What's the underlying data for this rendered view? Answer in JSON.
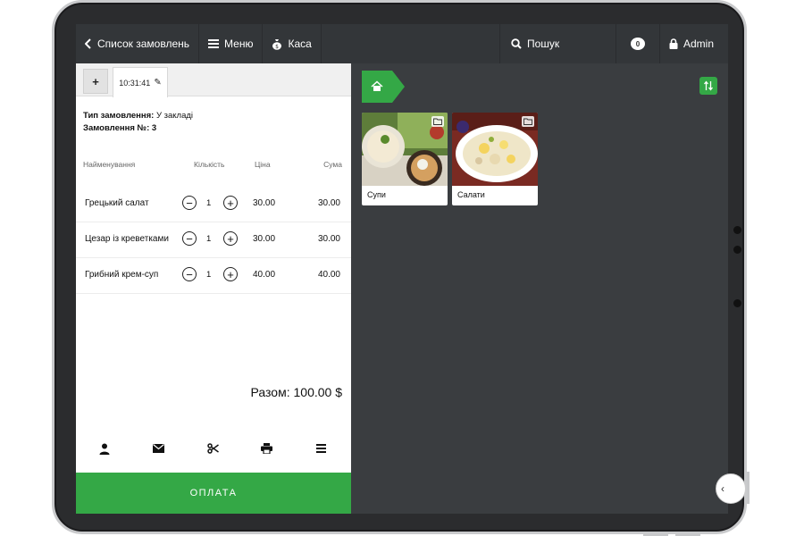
{
  "topbar": {
    "orders_label": "Список замовлень",
    "menu_label": "Меню",
    "cash_label": "Каса",
    "search_label": "Пошук",
    "messages_count": "0",
    "user_label": "Admin"
  },
  "order": {
    "new_tab_label": "+",
    "tab_time": "10:31:41",
    "type_label": "Тип замовлення:",
    "type_value": "У закладі",
    "number_label": "Замовлення №:",
    "number_value": "3",
    "columns": {
      "name": "Найменування",
      "qty": "Кількість",
      "price": "Ціна",
      "sum": "Сума"
    },
    "items": [
      {
        "name": "Грецький салат",
        "qty": "1",
        "price": "30.00",
        "sum": "30.00"
      },
      {
        "name": "Цезар із креветками",
        "qty": "1",
        "price": "30.00",
        "sum": "30.00"
      },
      {
        "name": "Грибний крем-суп",
        "qty": "1",
        "price": "40.00",
        "sum": "40.00"
      }
    ],
    "total": "Разом: 100.00 $",
    "pay_label": "ОПЛАТА"
  },
  "categories": [
    {
      "label": "Супи",
      "icon": "folder-icon"
    },
    {
      "label": "Салати",
      "icon": "folder-icon"
    }
  ],
  "colors": {
    "accent": "#34a846",
    "topbar": "#333639",
    "workspace": "#3a3d40"
  }
}
